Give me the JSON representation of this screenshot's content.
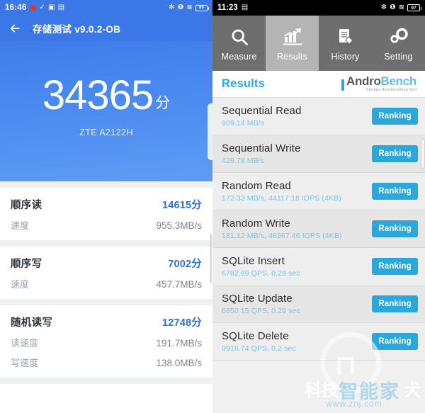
{
  "left_phone": {
    "status_bar": {
      "time": "16:46",
      "left_icons": [
        "record-dot-icon",
        "check-icon",
        "screenshot-icon",
        "split-screen-icon"
      ],
      "right_icons": [
        "bluetooth-icon",
        "vibrate-icon",
        "wifi-icon"
      ],
      "battery_level": "86"
    },
    "app_bar": {
      "back_icon": "back-arrow-icon",
      "title": "存储测试 v9.0.2-OB"
    },
    "hero": {
      "score": "34365",
      "unit": "分",
      "device": "ZTE A2122H"
    },
    "results": [
      {
        "name": "顺序读",
        "score": "14615分",
        "details": [
          {
            "label": "速度",
            "value": "955.3MB/s"
          }
        ]
      },
      {
        "name": "顺序写",
        "score": "7002分",
        "details": [
          {
            "label": "速度",
            "value": "457.7MB/s"
          }
        ]
      },
      {
        "name": "随机读写",
        "score": "12748分",
        "details": [
          {
            "label": "读速度",
            "value": "191.7MB/s"
          },
          {
            "label": "写速度",
            "value": "138.0MB/s"
          }
        ]
      }
    ]
  },
  "right_phone": {
    "status_bar": {
      "time": "11:23",
      "left_icons": [
        "split-screen-icon"
      ],
      "right_icons": [
        "bluetooth-icon",
        "vibrate-icon",
        "wifi-icon"
      ],
      "battery_level": "97"
    },
    "tabs": [
      {
        "label": "Measure",
        "icon": "magnifier-icon",
        "active": false
      },
      {
        "label": "Results",
        "icon": "bar-chart-icon",
        "active": true
      },
      {
        "label": "History",
        "icon": "document-pen-icon",
        "active": false
      },
      {
        "label": "Setting",
        "icon": "gears-icon",
        "active": false
      }
    ],
    "header": {
      "title": "Results",
      "logo_part1": "Andro",
      "logo_part2": "Bench",
      "logo_subtitle": "Storage Benchmarking Tool"
    },
    "ranking_button_label": "Ranking",
    "results": [
      {
        "title": "Sequential Read",
        "detail": "909.14 MB/s"
      },
      {
        "title": "Sequential Write",
        "detail": "429.78 MB/s"
      },
      {
        "title": "Random Read",
        "detail": "172.33 MB/s, 44117.18 IOPS (4KB)"
      },
      {
        "title": "Random Write",
        "detail": "181.12 MB/s, 46367.46 IOPS (4KB)"
      },
      {
        "title": "SQLite Insert",
        "detail": "6782.69 QPS, 0.29 sec"
      },
      {
        "title": "SQLite Update",
        "detail": "6850.15 QPS, 0.29 sec"
      },
      {
        "title": "SQLite Delete",
        "detail": "9916.74 QPS, 0.2 sec"
      }
    ]
  },
  "watermark": {
    "text_left": "科技",
    "text_right": "犬",
    "text_overlay": "智能家",
    "url": "www.znj.com"
  },
  "colors": {
    "left_blue": "#3c77e8",
    "left_score_blue": "#2f6fd8",
    "androbench_blue": "#29a8dd",
    "tab_inactive": "#6e6e6e",
    "tab_active": "#b4b4b4"
  }
}
